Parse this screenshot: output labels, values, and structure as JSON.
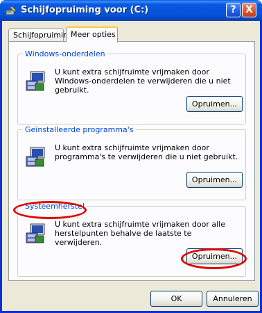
{
  "window": {
    "title": "Schijfopruiming voor  (C:)",
    "help_label": "?",
    "close_label": "X"
  },
  "tabs": [
    {
      "label": "Schijfopruiming"
    },
    {
      "label": "Meer opties"
    }
  ],
  "groups": [
    {
      "title": "Windows-onderdelen",
      "description": "U kunt extra schijfruimte vrijmaken door Windows-onderdelen te verwijderen die u niet gebruikt.",
      "button_label": "Opruimen..."
    },
    {
      "title": "Geïnstalleerde programma's",
      "description": "U kunt extra schijfruimte vrijmaken door programma's te verwijderen die u niet gebruikt.",
      "button_label": "Opruimen..."
    },
    {
      "title": "Systeemherstel",
      "description": "U kunt extra schijfruimte vrijmaken door alle herstelpunten behalve de laatste te verwijderen.",
      "button_label": "Opruimen..."
    }
  ],
  "footer": {
    "ok_label": "OK",
    "cancel_label": "Annuleren"
  },
  "colors": {
    "titlebar": "#0653d7",
    "group_title": "#0046d5",
    "highlight": "#e00000"
  }
}
